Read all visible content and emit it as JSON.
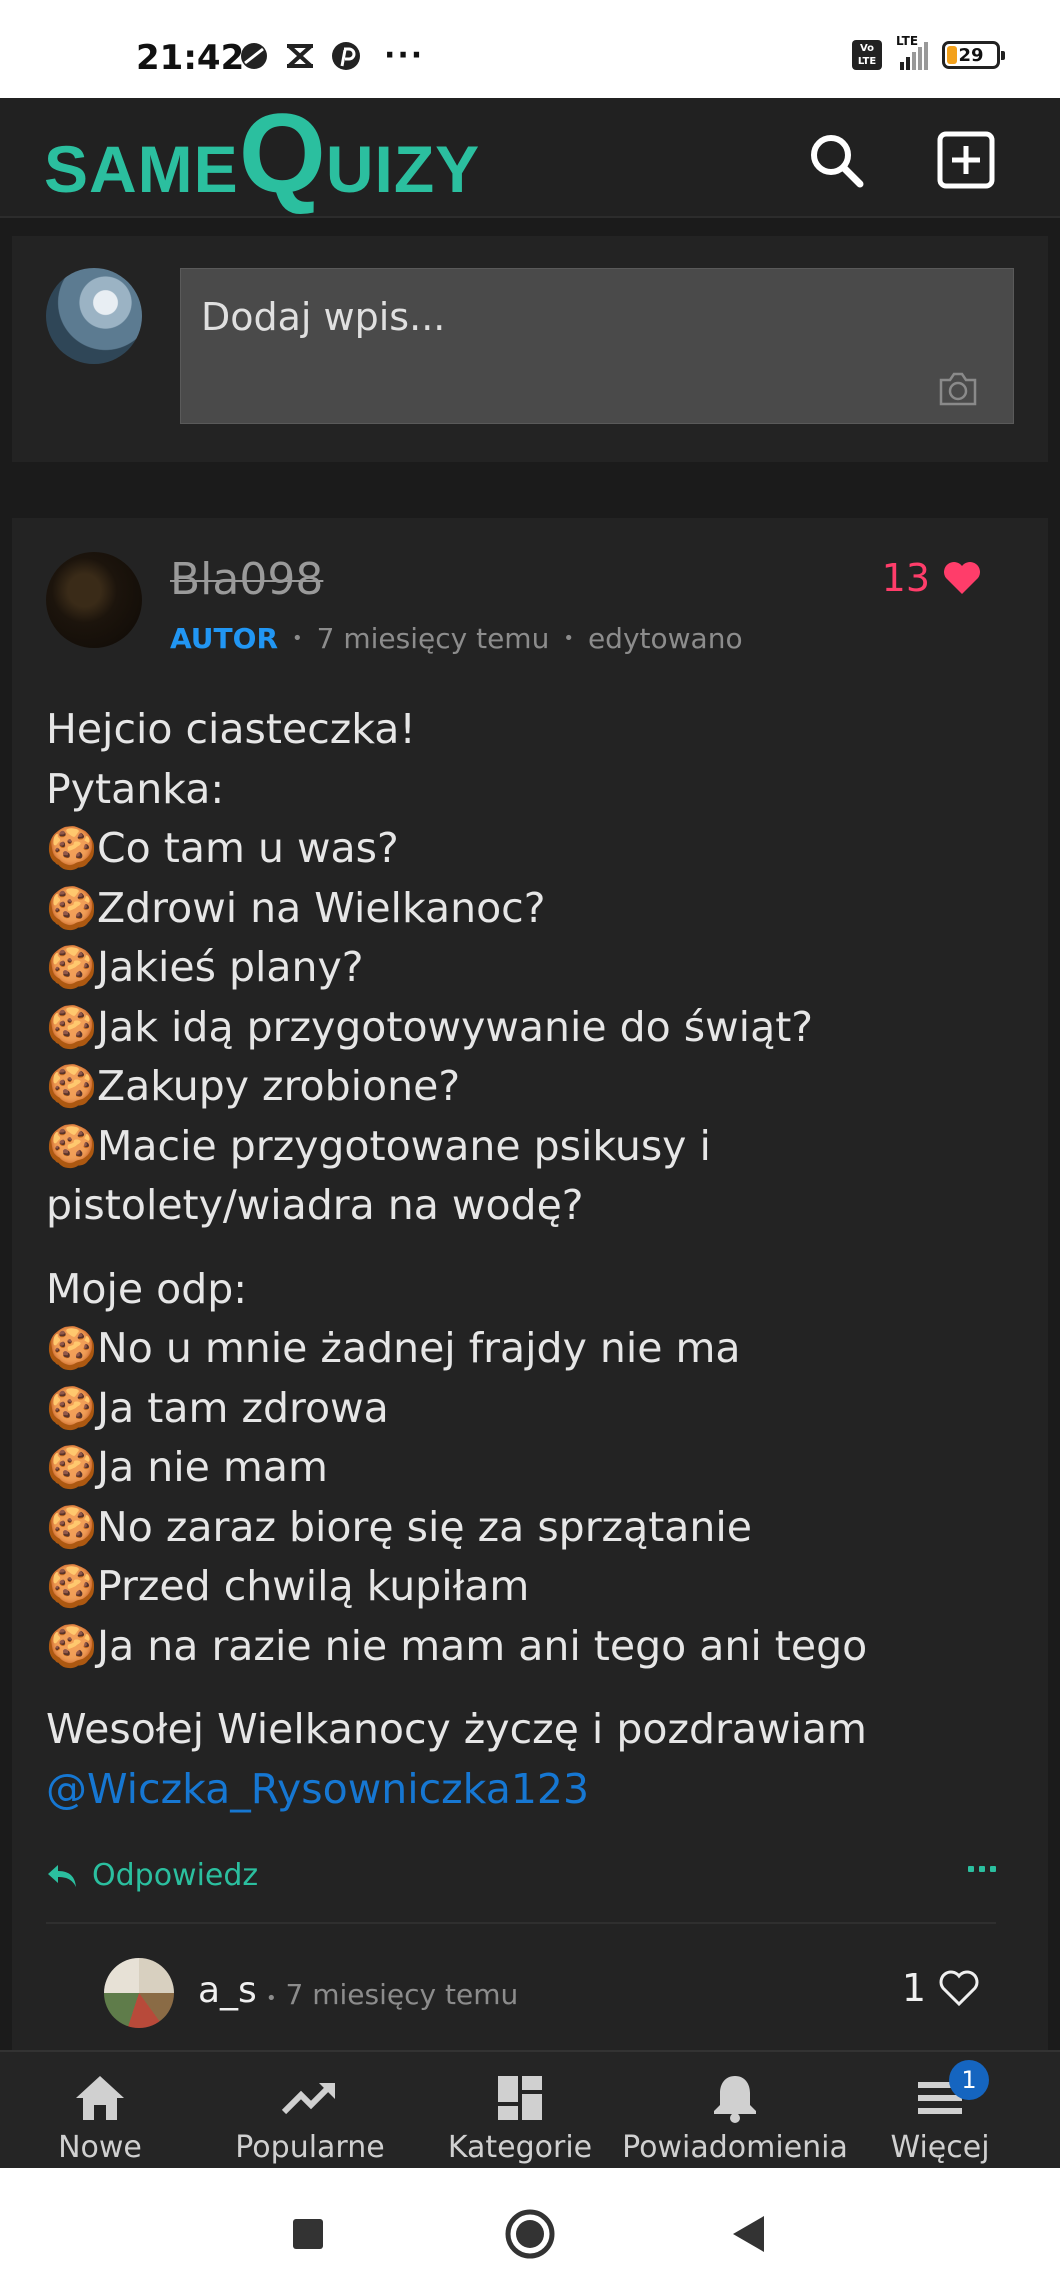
{
  "status_bar": {
    "time": "21:42",
    "battery": "29",
    "network": "LTE",
    "volte": "Vo LTE",
    "more": "···"
  },
  "app": {
    "logo_part1": "SAME",
    "logo_q": "Q",
    "logo_part2": "UIZY",
    "accent_color": "#2bbf9f"
  },
  "compose": {
    "placeholder": "Dodaj wpis..."
  },
  "post": {
    "author": "Bla098",
    "role": "AUTOR",
    "time": "7 miesięcy temu",
    "edited": "edytowano",
    "likes": "13",
    "lines_block1": [
      "Hejcio ciasteczka!",
      "Pytanka:",
      "🍪Co tam u was?",
      "🍪Zdrowi na Wielkanoc?",
      "🍪Jakieś plany?",
      "🍪Jak idą przygotowywanie do świąt?",
      "🍪Zakupy zrobione?",
      "🍪Macie przygotowane psikusy i pistolety/wiadra na wodę?"
    ],
    "lines_block2": [
      "Moje odp:",
      "🍪No u mnie żadnej frajdy nie ma",
      "🍪Ja tam zdrowa",
      "🍪Ja nie mam",
      "🍪No zaraz biorę się za sprzątanie",
      "🍪Przed chwilą kupiłam",
      "🍪Ja na razie nie mam ani tego ani tego"
    ],
    "closing": "Wesołej Wielkanocy życzę i pozdrawiam",
    "mention": "@Wiczka_Rysowniczka123",
    "reply_label": "Odpowiedz"
  },
  "comment": {
    "author": "a_s",
    "time": "7 miesięcy temu",
    "likes": "1"
  },
  "bottom_nav": {
    "items": [
      {
        "label": "Nowe",
        "icon": "home-icon"
      },
      {
        "label": "Popularne",
        "icon": "trending-icon"
      },
      {
        "label": "Kategorie",
        "icon": "dashboard-icon"
      },
      {
        "label": "Powiadomienia",
        "icon": "bell-icon"
      },
      {
        "label": "Więcej",
        "icon": "menu-icon"
      }
    ],
    "more_badge": "1"
  }
}
